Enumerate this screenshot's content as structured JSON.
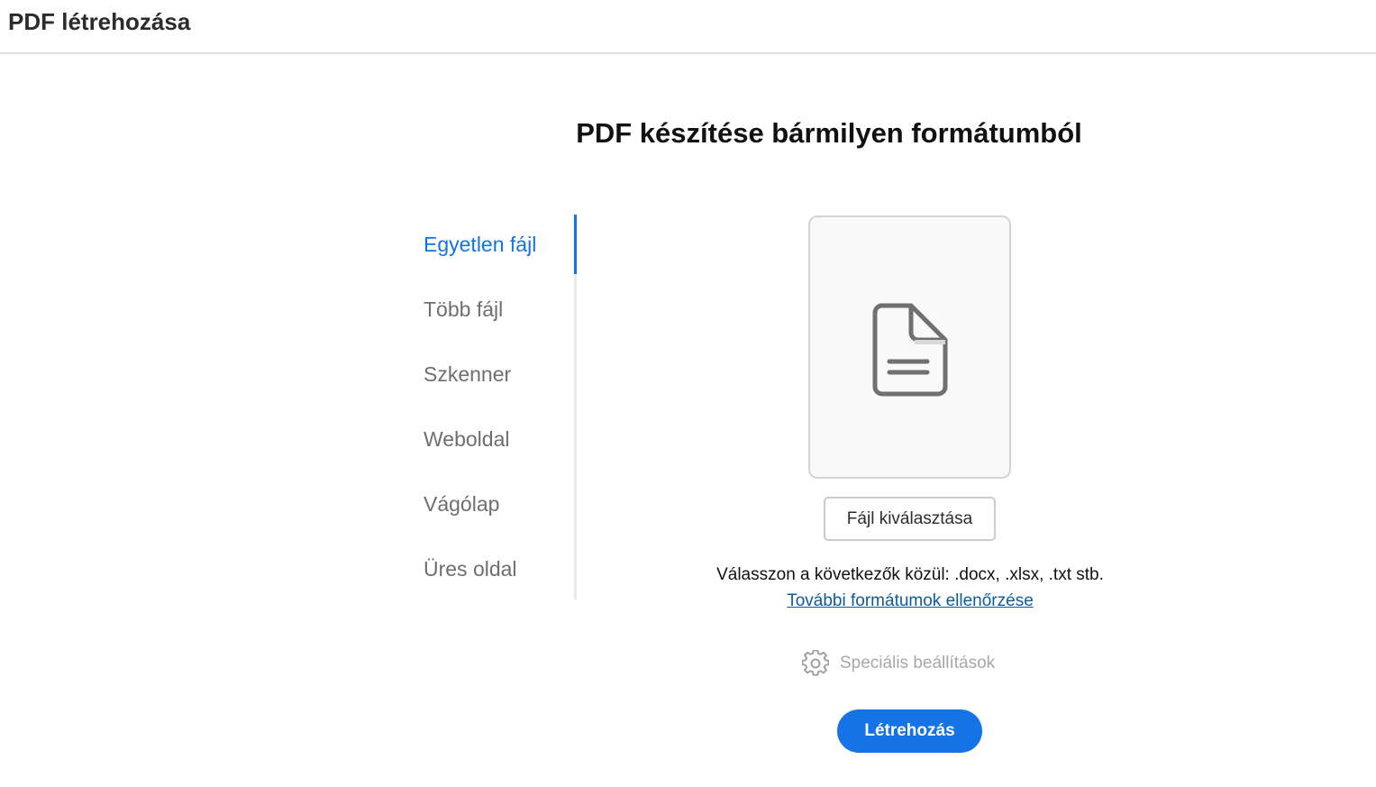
{
  "header": {
    "title": "PDF létrehozása"
  },
  "main": {
    "heading": "PDF készítése bármilyen formátumból"
  },
  "sidebar": {
    "items": [
      {
        "label": "Egyetlen fájl",
        "active": true
      },
      {
        "label": "Több fájl",
        "active": false
      },
      {
        "label": "Szkenner",
        "active": false
      },
      {
        "label": "Weboldal",
        "active": false
      },
      {
        "label": "Vágólap",
        "active": false
      },
      {
        "label": "Üres oldal",
        "active": false
      }
    ]
  },
  "dropzone": {
    "icon": "document-icon"
  },
  "actions": {
    "choose_file_label": "Fájl kiválasztása",
    "hint_text": "Válasszon a következők közül: .docx, .xlsx, .txt stb.",
    "formats_link": "További formátumok ellenőrzése",
    "advanced_label": "Speciális beállítások",
    "advanced_icon": "gear-icon",
    "create_label": "Létrehozás"
  },
  "colors": {
    "accent": "#1473e6",
    "link": "#0d5b9e",
    "muted": "#a7a7a7",
    "nav_inactive": "#6e6e6e"
  }
}
